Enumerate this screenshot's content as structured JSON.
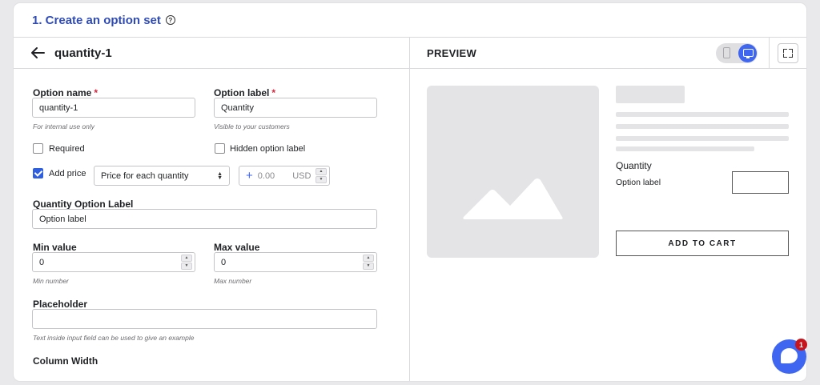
{
  "header": {
    "title": "1. Create an option set",
    "help_icon": "?"
  },
  "editor": {
    "title": "quantity-1",
    "option_name": {
      "label": "Option name",
      "required_mark": "*",
      "value": "quantity-1",
      "help": "For internal use only"
    },
    "option_label": {
      "label": "Option label",
      "required_mark": "*",
      "value": "Quantity",
      "help": "Visible to your customers"
    },
    "required": {
      "label": "Required",
      "checked": false
    },
    "hidden_label": {
      "label": "Hidden option label",
      "checked": false
    },
    "add_price": {
      "label": "Add price",
      "checked": true,
      "mode": "Price for each quantity",
      "price_placeholder": "0.00",
      "currency": "USD"
    },
    "quantity_option_label": {
      "label": "Quantity Option Label",
      "value": "Option label"
    },
    "min_value": {
      "label": "Min value",
      "value": "0",
      "help": "Min number"
    },
    "max_value": {
      "label": "Max value",
      "value": "0",
      "help": "Max number"
    },
    "placeholder": {
      "label": "Placeholder",
      "value": "",
      "help": "Text inside input field can be used to give an example"
    },
    "column_width": {
      "label": "Column Width"
    }
  },
  "preview": {
    "title": "PREVIEW",
    "option_title": "Quantity",
    "option_label": "Option label",
    "add_to_cart": "ADD TO CART",
    "view_mode": "desktop"
  },
  "chat": {
    "badge_count": "1"
  },
  "colors": {
    "accent": "#3f66f0",
    "title": "#2f4bb5",
    "required": "#d7263d",
    "badge": "#c7151e"
  }
}
